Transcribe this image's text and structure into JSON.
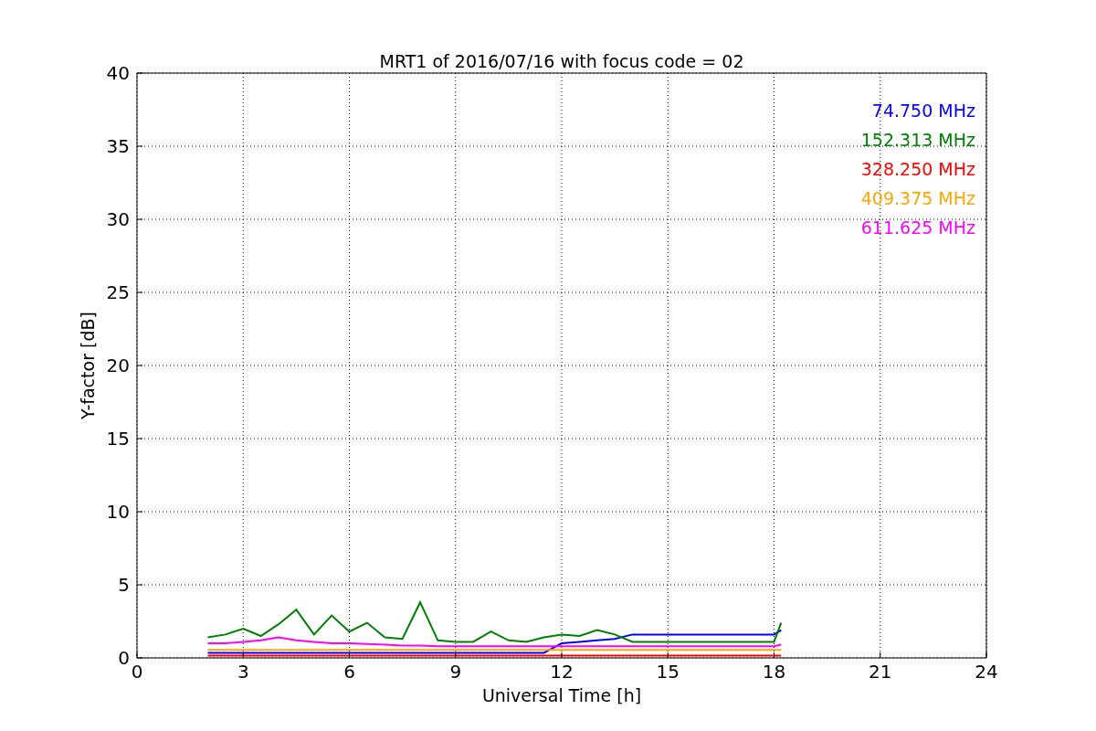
{
  "figure": {
    "chart_data": {
      "type": "line",
      "title": "MRT1 of 2016/07/16 with focus code = 02",
      "xlabel": "Universal Time [h]",
      "ylabel": "Y-factor [dB]",
      "x": [
        2,
        2.5,
        3,
        3.5,
        4,
        4.5,
        5,
        5.5,
        6,
        6.5,
        7,
        7.5,
        8,
        8.5,
        9,
        9.5,
        10,
        10.5,
        11,
        11.5,
        12,
        12.5,
        13,
        13.5,
        14,
        18,
        18.2
      ],
      "series": [
        {
          "name": "74.750 MHz",
          "color": "#0000ff",
          "values": [
            0.35,
            0.35,
            0.35,
            0.35,
            0.35,
            0.35,
            0.35,
            0.35,
            0.35,
            0.35,
            0.35,
            0.35,
            0.35,
            0.35,
            0.35,
            0.35,
            0.35,
            0.35,
            0.35,
            0.35,
            1.0,
            1.1,
            1.2,
            1.3,
            1.6,
            1.6,
            1.9
          ]
        },
        {
          "name": "152.313 MHz",
          "color": "#008000",
          "values": [
            1.4,
            1.6,
            2.0,
            1.5,
            2.3,
            3.3,
            1.6,
            2.9,
            1.8,
            2.4,
            1.4,
            1.3,
            3.8,
            1.2,
            1.1,
            1.1,
            1.8,
            1.2,
            1.1,
            1.4,
            1.6,
            1.5,
            1.9,
            1.6,
            1.1,
            1.1,
            2.4
          ]
        },
        {
          "name": "328.250 MHz",
          "color": "#ff0000",
          "values": [
            0.15,
            0.15,
            0.15,
            0.15,
            0.15,
            0.15,
            0.15,
            0.15,
            0.15,
            0.15,
            0.15,
            0.15,
            0.15,
            0.15,
            0.15,
            0.15,
            0.15,
            0.15,
            0.15,
            0.15,
            0.15,
            0.15,
            0.15,
            0.15,
            0.15,
            0.15,
            0.15
          ]
        },
        {
          "name": "409.375 MHz",
          "color": "#ffa500",
          "values": [
            0.55,
            0.55,
            0.55,
            0.55,
            0.55,
            0.55,
            0.55,
            0.55,
            0.55,
            0.55,
            0.55,
            0.55,
            0.55,
            0.55,
            0.55,
            0.55,
            0.55,
            0.55,
            0.55,
            0.55,
            0.55,
            0.55,
            0.55,
            0.55,
            0.55,
            0.55,
            0.55
          ]
        },
        {
          "name": "611.625 MHz",
          "color": "#ff00ff",
          "values": [
            1.0,
            1.0,
            1.1,
            1.2,
            1.4,
            1.2,
            1.1,
            1.0,
            1.0,
            0.95,
            0.9,
            0.85,
            0.85,
            0.8,
            0.8,
            0.8,
            0.8,
            0.8,
            0.8,
            0.8,
            0.8,
            0.8,
            0.8,
            0.8,
            0.8,
            0.8,
            0.9
          ]
        }
      ],
      "xlim": [
        0,
        24
      ],
      "ylim": [
        0,
        40
      ],
      "xticks": [
        0,
        3,
        6,
        9,
        12,
        15,
        18,
        21,
        24
      ],
      "yticks": [
        0,
        5,
        10,
        15,
        20,
        25,
        30,
        35,
        40
      ],
      "grid": true
    }
  }
}
